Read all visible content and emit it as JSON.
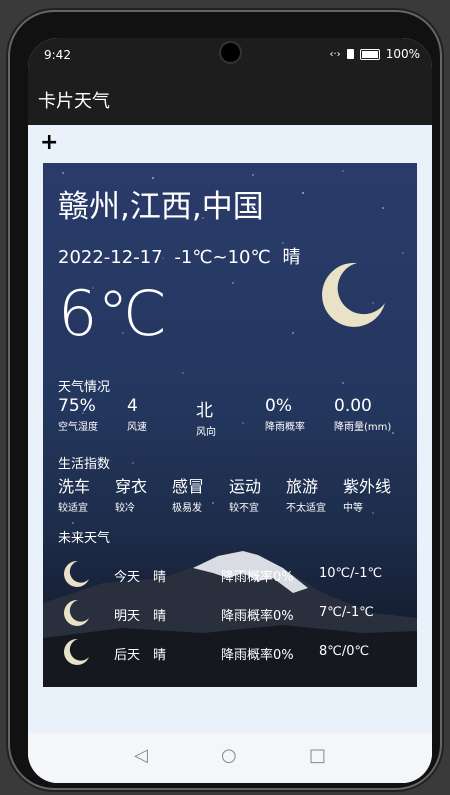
{
  "status": {
    "time": "9:42",
    "battery": "100%"
  },
  "app": {
    "title": "卡片天气",
    "add_label": "+"
  },
  "card": {
    "city": "赣州,江西,中国",
    "date": "2022-12-17",
    "range": "-1℃~10℃",
    "weather": "晴",
    "temp": "6℃",
    "section_weather": "天气情况",
    "details": [
      {
        "value": "75%",
        "label": "空气湿度"
      },
      {
        "value": "4",
        "label": "风速"
      },
      {
        "value": "北",
        "label": "风向"
      },
      {
        "value": "0%",
        "label": "降雨概率"
      },
      {
        "value": "0.00",
        "label": "降雨量(mm)"
      }
    ],
    "section_life": "生活指数",
    "life": [
      {
        "value": "洗车",
        "label": "较适宜"
      },
      {
        "value": "穿衣",
        "label": "较冷"
      },
      {
        "value": "感冒",
        "label": "极易发"
      },
      {
        "value": "运动",
        "label": "较不宜"
      },
      {
        "value": "旅游",
        "label": "不太适宜"
      },
      {
        "value": "紫外线",
        "label": "中等"
      }
    ],
    "section_future": "未来天气",
    "forecast": [
      {
        "day": "今天",
        "weather": "晴",
        "rain": "降雨概率0%",
        "range": "10℃/-1℃"
      },
      {
        "day": "明天",
        "weather": "晴",
        "rain": "降雨概率0%",
        "range": "7℃/-1℃"
      },
      {
        "day": "后天",
        "weather": "晴",
        "rain": "降雨概率0%",
        "range": "8℃/0℃"
      }
    ]
  },
  "icons": {
    "moon": "crescent-moon-icon",
    "back": "back-triangle-icon",
    "home": "home-circle-icon",
    "recent": "recent-square-icon"
  },
  "colors": {
    "moon": "#e9e2c6",
    "bar": "#1d1d1d",
    "screen_bg": "#e9f2fb"
  }
}
